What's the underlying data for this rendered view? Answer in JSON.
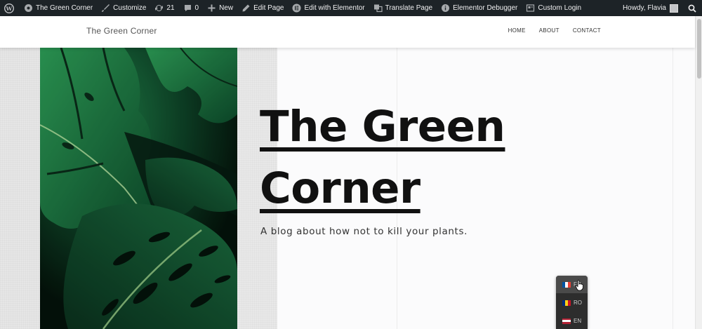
{
  "adminbar": {
    "items": [
      {
        "label": "The Green Corner",
        "icon": "home-icon"
      },
      {
        "label": "Customize",
        "icon": "brush-icon"
      },
      {
        "label": "21",
        "icon": "updates-icon"
      },
      {
        "label": "0",
        "icon": "comment-icon"
      },
      {
        "label": "New",
        "icon": "plus-icon"
      },
      {
        "label": "Edit Page",
        "icon": "pencil-icon"
      },
      {
        "label": "Edit with Elementor",
        "icon": "elementor-icon"
      },
      {
        "label": "Translate Page",
        "icon": "translate-icon"
      },
      {
        "label": "Elementor Debugger",
        "icon": "info-icon"
      },
      {
        "label": "Custom Login",
        "icon": "login-icon"
      }
    ],
    "howdy": "Howdy, Flavia",
    "icons": {
      "wp_logo": "wordpress-logo-icon",
      "search": "search-icon"
    }
  },
  "site": {
    "title": "The Green Corner",
    "nav": [
      "HOME",
      "ABOUT",
      "CONTACT"
    ]
  },
  "hero": {
    "title_line1": "The Green",
    "title_line2": "Corner",
    "subtitle": "A blog about how not to kill your plants."
  },
  "language_switcher": {
    "items": [
      {
        "code": "FR",
        "flag_colors": [
          "#0055a4",
          "#ffffff",
          "#ef4135"
        ],
        "active": true
      },
      {
        "code": "RO",
        "flag_colors": [
          "#002b7f",
          "#fcd116",
          "#ce1126"
        ],
        "active": false
      },
      {
        "code": "EN",
        "flag_colors": [
          "#b22234",
          "#ffffff",
          "#3c3b6e"
        ],
        "active": false
      }
    ]
  },
  "colors": {
    "adminbar_bg": "#1d2327",
    "adminbar_text": "#f0f0f1",
    "hero_text": "#111111",
    "leaf_green": "#1f7a45"
  }
}
